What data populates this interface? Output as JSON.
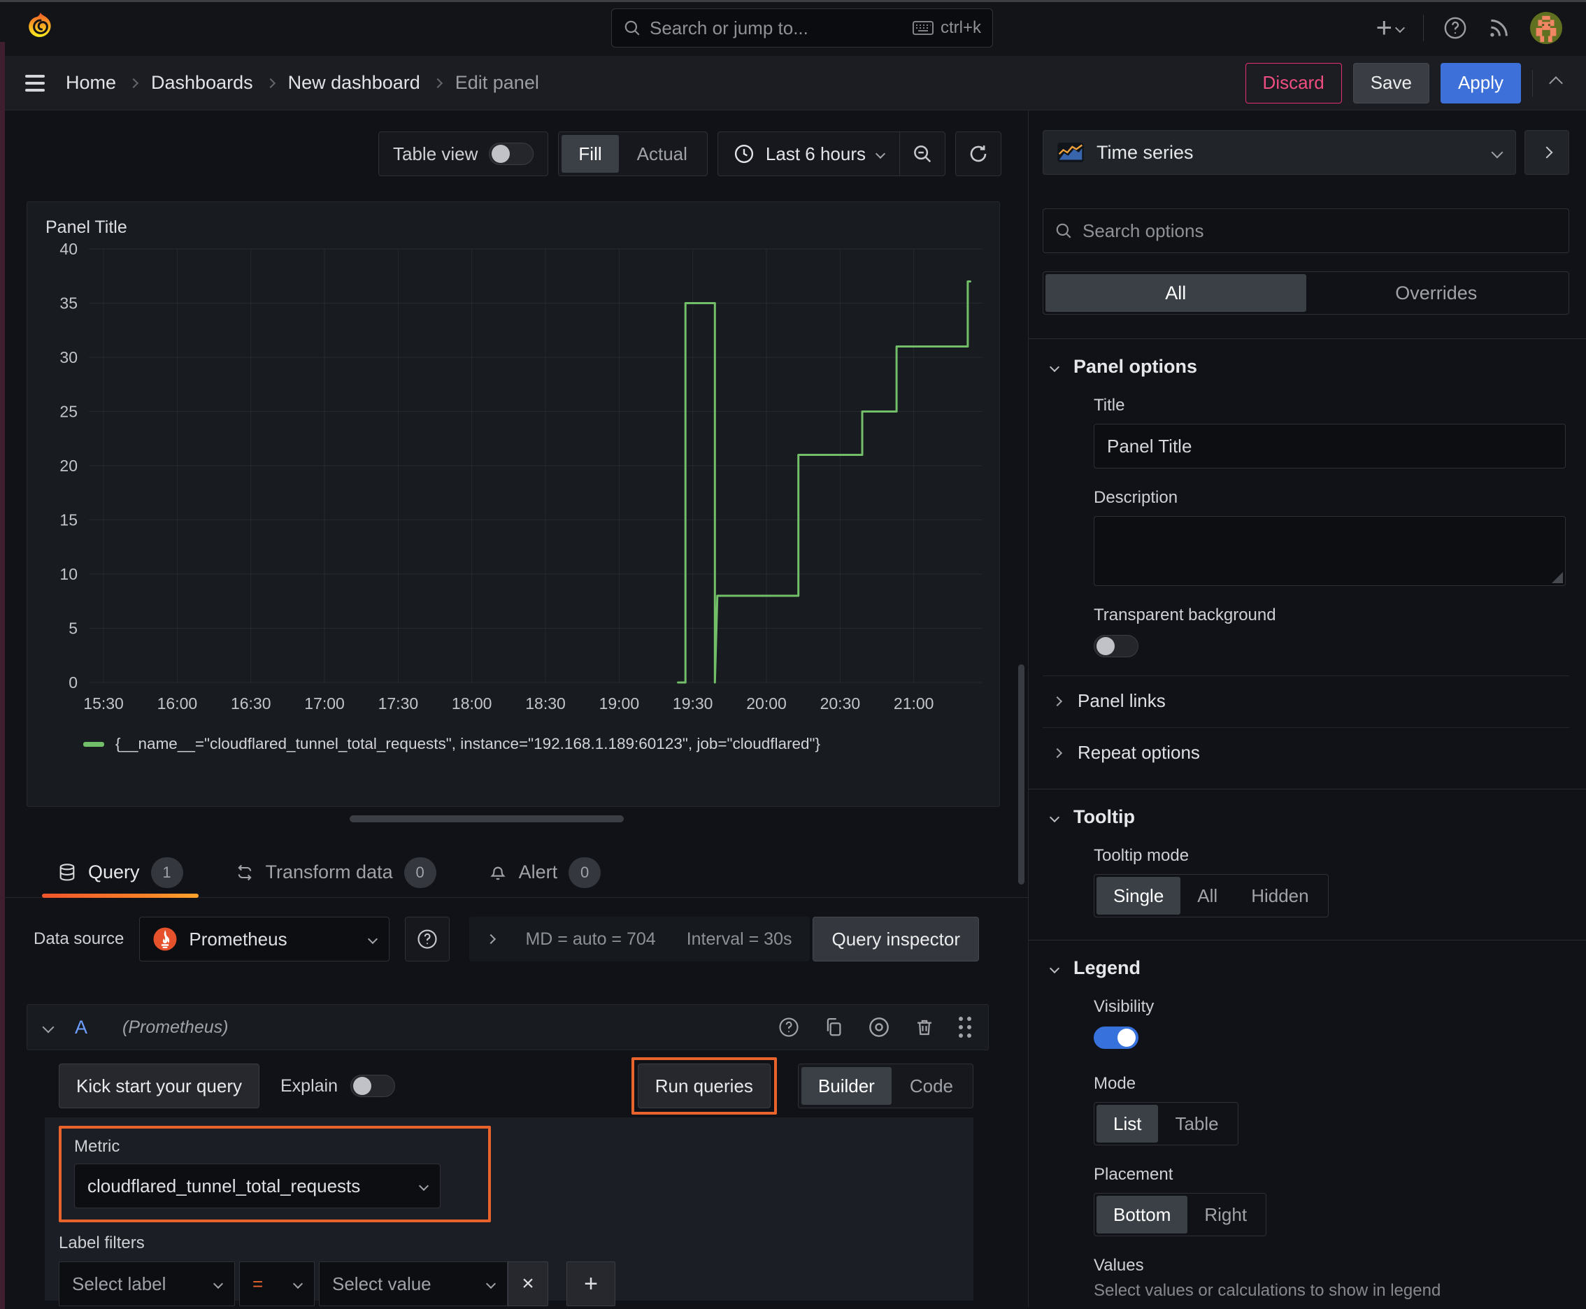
{
  "topnav": {
    "search_placeholder": "Search or jump to...",
    "search_shortcut": "ctrl+k"
  },
  "breadcrumb": {
    "items": [
      "Home",
      "Dashboards",
      "New dashboard",
      "Edit panel"
    ]
  },
  "actions": {
    "discard": "Discard",
    "save": "Save",
    "apply": "Apply"
  },
  "toolbar": {
    "table_view_label": "Table view",
    "display_modes": [
      "Fill",
      "Actual"
    ],
    "display_selected": "Fill",
    "time_range": "Last 6 hours"
  },
  "viz_picker": {
    "label": "Time series"
  },
  "panel": {
    "title": "Panel Title"
  },
  "chart_data": {
    "type": "line",
    "title": "Panel Title",
    "x_ticks": [
      "15:30",
      "16:00",
      "16:30",
      "17:00",
      "17:30",
      "18:00",
      "18:30",
      "19:00",
      "19:30",
      "20:00",
      "20:30",
      "21:00"
    ],
    "y_ticks": [
      0,
      5,
      10,
      15,
      20,
      25,
      30,
      35,
      40
    ],
    "ylim": [
      0,
      40
    ],
    "x_domain_minutes": [
      "15:24",
      "21:28"
    ],
    "grid": true,
    "legend_position": "bottom",
    "series": [
      {
        "name": "{__name__=\"cloudflared_tunnel_total_requests\", instance=\"192.168.1.189:60123\", job=\"cloudflared\"}",
        "color": "#73bf69",
        "points": [
          [
            "19:24",
            0
          ],
          [
            "19:27",
            0
          ],
          [
            "19:27",
            35
          ],
          [
            "19:39",
            35
          ],
          [
            "19:39",
            0
          ],
          [
            "19:40",
            8
          ],
          [
            "20:13",
            8
          ],
          [
            "20:13",
            21
          ],
          [
            "20:39",
            21
          ],
          [
            "20:39",
            25
          ],
          [
            "20:53",
            25
          ],
          [
            "20:53",
            31
          ],
          [
            "21:22",
            31
          ],
          [
            "21:22",
            37
          ],
          [
            "21:23",
            37
          ]
        ]
      }
    ]
  },
  "query_tabs": {
    "query": {
      "label": "Query",
      "count": "1"
    },
    "transform": {
      "label": "Transform data",
      "count": "0"
    },
    "alert": {
      "label": "Alert",
      "count": "0"
    }
  },
  "datasource_bar": {
    "label": "Data source",
    "value": "Prometheus",
    "stats": [
      "MD = auto = 704",
      "Interval = 30s"
    ],
    "inspector": "Query inspector"
  },
  "query_editor": {
    "ref_id": "A",
    "datasource_hint": "(Prometheus)",
    "kick_start": "Kick start your query",
    "explain_label": "Explain",
    "run_queries": "Run queries",
    "modes": [
      "Builder",
      "Code"
    ],
    "mode_selected": "Builder",
    "metric_label": "Metric",
    "metric_value": "cloudflared_tunnel_total_requests",
    "label_filters_label": "Label filters",
    "select_label_placeholder": "Select label",
    "operator": "=",
    "select_value_placeholder": "Select value",
    "remove_label": "×",
    "add_label": "+"
  },
  "options_pane": {
    "search_placeholder": "Search options",
    "tabs": {
      "all": "All",
      "overrides": "Overrides"
    },
    "panel_options": {
      "title": "Panel options",
      "title_label": "Title",
      "title_value": "Panel Title",
      "description_label": "Description",
      "transparent_label": "Transparent background"
    },
    "links_label": "Panel links",
    "repeat_label": "Repeat options",
    "tooltip": {
      "title": "Tooltip",
      "mode_label": "Tooltip mode",
      "modes": [
        "Single",
        "All",
        "Hidden"
      ],
      "selected": "Single"
    },
    "legend": {
      "title": "Legend",
      "visibility_label": "Visibility",
      "mode_label": "Mode",
      "modes": [
        "List",
        "Table"
      ],
      "mode_selected": "List",
      "placement_label": "Placement",
      "placements": [
        "Bottom",
        "Right"
      ],
      "placement_selected": "Bottom",
      "values_label": "Values",
      "values_hint": "Select values or calculations to show in legend"
    }
  },
  "colors": {
    "annotation_orange": "#e8642c",
    "series_green": "#73bf69",
    "accent_blue": "#3d71d9",
    "discard_pink": "#e0316c"
  }
}
